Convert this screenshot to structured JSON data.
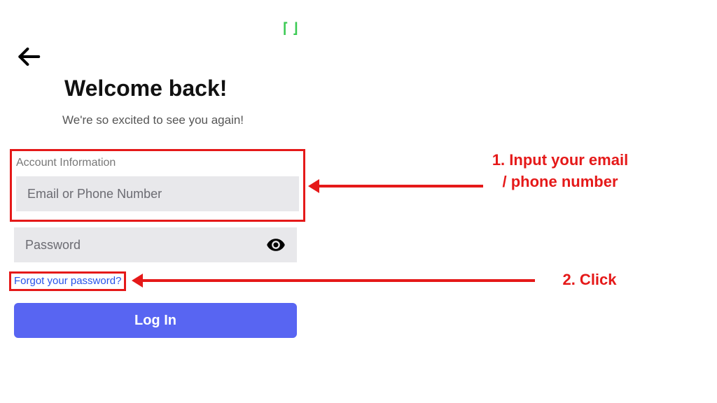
{
  "header": {
    "title": "Welcome back!",
    "subtitle": "We're so excited to see you again!"
  },
  "account": {
    "section_label": "Account Information",
    "email_placeholder": "Email or Phone Number"
  },
  "password": {
    "placeholder": "Password"
  },
  "forgot_link": "Forgot your password?",
  "login_button": "Log In",
  "annotations": {
    "step1": "1. Input your email / phone number",
    "step2": "2. Click"
  }
}
